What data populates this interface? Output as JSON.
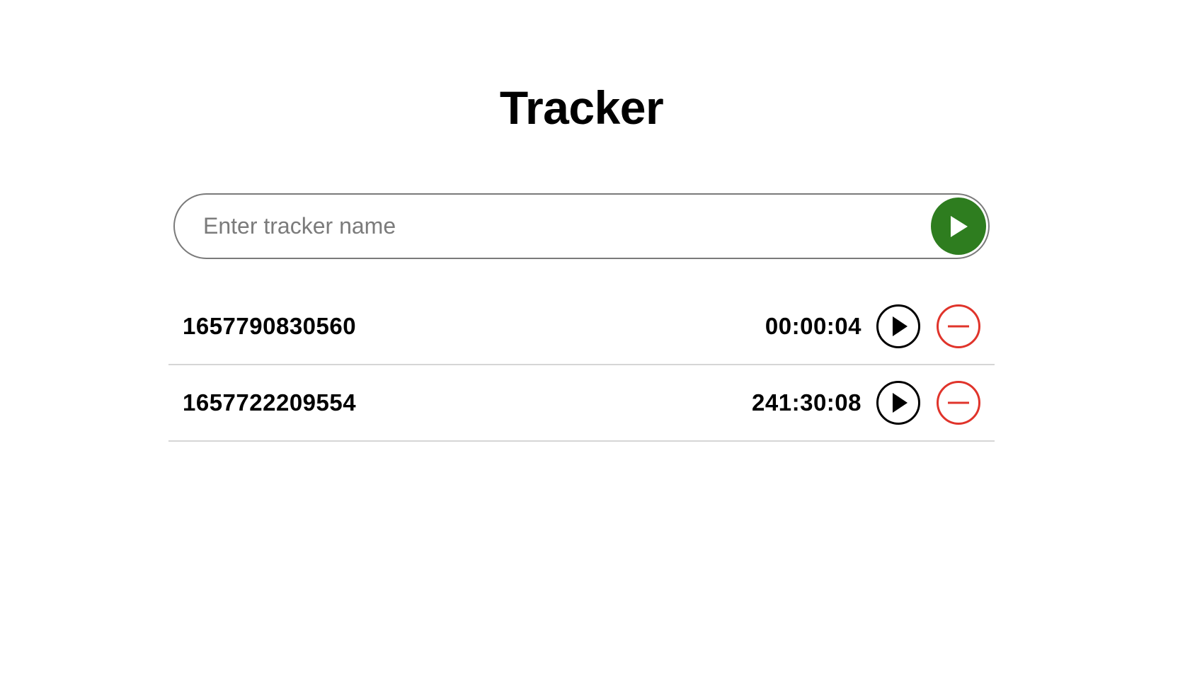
{
  "header": {
    "title": "Tracker"
  },
  "new_tracker": {
    "placeholder": "Enter tracker name",
    "value": "",
    "start_icon": "play-icon",
    "start_color": "#2e7d1f"
  },
  "trackers": [
    {
      "name": "1657790830560",
      "elapsed": "00:00:04",
      "play_icon": "play-circle-icon",
      "remove_icon": "minus-circle-icon"
    },
    {
      "name": "1657722209554",
      "elapsed": "241:30:08",
      "play_icon": "play-circle-icon",
      "remove_icon": "minus-circle-icon"
    }
  ],
  "colors": {
    "remove": "#e0342b",
    "text": "#000000",
    "divider": "#d6d6d6"
  }
}
